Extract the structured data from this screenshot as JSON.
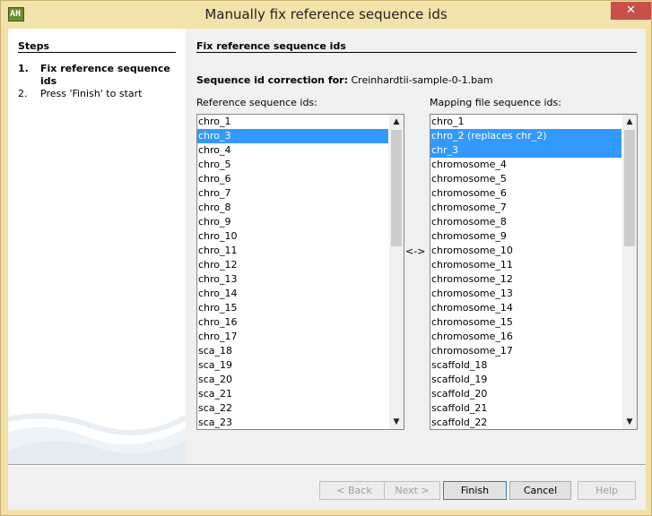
{
  "window": {
    "title": "Manually fix reference sequence ids",
    "close_glyph": "✕",
    "icon_text": "AH"
  },
  "steps": {
    "title": "Steps",
    "items": [
      {
        "num": "1.",
        "label": "Fix reference sequence ids"
      },
      {
        "num": "2.",
        "label": "Press 'Finish' to start"
      }
    ]
  },
  "main": {
    "title": "Fix reference sequence ids",
    "seq_label": "Sequence id correction for:",
    "seq_file": "Creinhardtii-sample-0-1.bam",
    "ref_label": "Reference sequence ids:",
    "map_label": "Mapping file sequence ids:",
    "swap_label": "<->"
  },
  "ref_list": [
    "chro_1",
    "chro_3",
    "chro_4",
    "chro_5",
    "chro_6",
    "chro_7",
    "chro_8",
    "chro_9",
    "chro_10",
    "chro_11",
    "chro_12",
    "chro_13",
    "chro_14",
    "chro_15",
    "chro_16",
    "chro_17",
    "sca_18",
    "sca_19",
    "sca_20",
    "sca_21",
    "sca_22",
    "sca_23"
  ],
  "ref_selected": [
    1
  ],
  "map_list": [
    "chro_1",
    "chro_2 (replaces chr_2)",
    "chr_3",
    "chromosome_4",
    "chromosome_5",
    "chromosome_6",
    "chromosome_7",
    "chromosome_8",
    "chromosome_9",
    "chromosome_10",
    "chromosome_11",
    "chromosome_12",
    "chromosome_13",
    "chromosome_14",
    "chromosome_15",
    "chromosome_16",
    "chromosome_17",
    "scaffold_18",
    "scaffold_19",
    "scaffold_20",
    "scaffold_21",
    "scaffold_22"
  ],
  "map_selected": [
    1,
    2
  ],
  "buttons": {
    "back": "< Back",
    "next": "Next >",
    "finish": "Finish",
    "cancel": "Cancel",
    "help": "Help"
  },
  "icons": {
    "scroll_up": "▲",
    "scroll_down": "▼"
  },
  "colors": {
    "selection": "#3399ff",
    "title_bar": "#f2e3ab",
    "close_button": "#c7504a"
  }
}
